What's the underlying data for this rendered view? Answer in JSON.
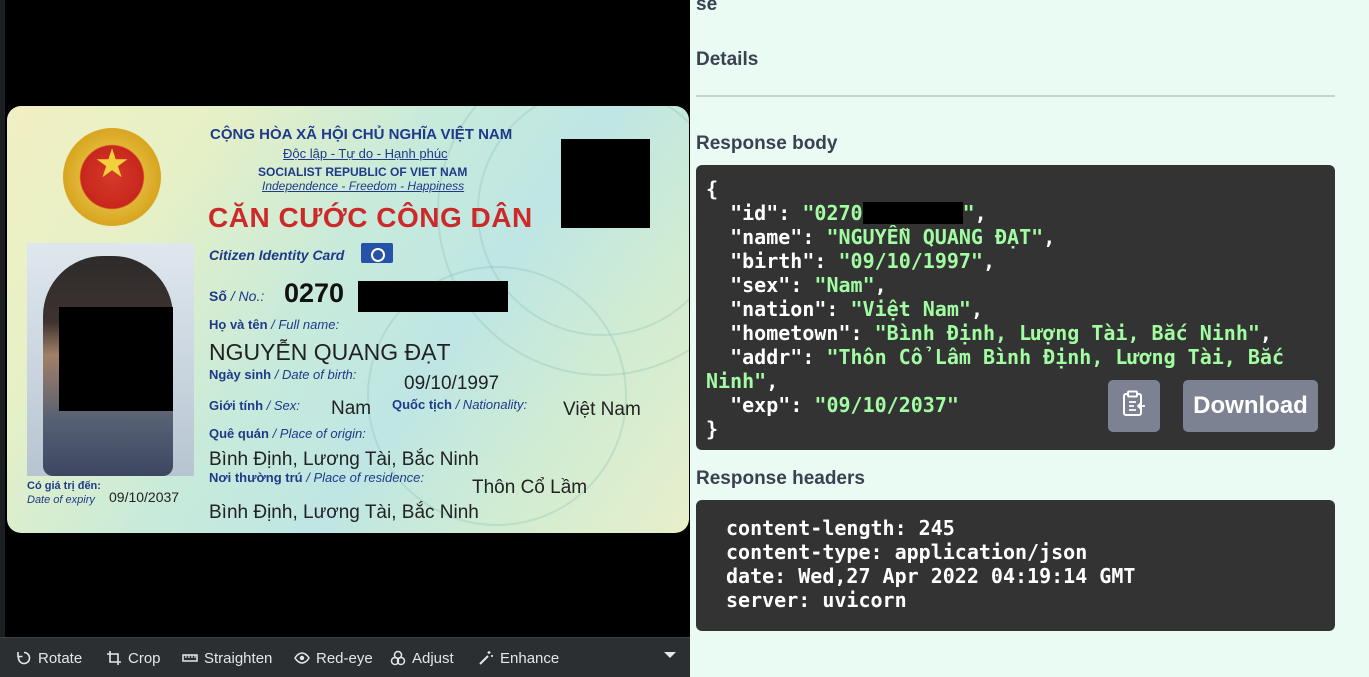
{
  "viewer": {
    "card": {
      "national_title": "CỘNG HÒA XÃ HỘI CHỦ NGHĨA VIỆT NAM",
      "motto": "Độc lập - Tự do - Hạnh phúc",
      "national_title_en": "SOCIALIST REPUBLIC OF VIET NAM",
      "motto_en": "Independence - Freedom - Happiness",
      "card_title": "CĂN CƯỚC CÔNG DÂN",
      "card_title_en": "Citizen Identity Card",
      "id_label": "Số",
      "id_label_en": "/ No.:",
      "id_number": "0270",
      "name_label": "Họ và tên",
      "name_label_en": "/ Full name:",
      "name": "NGUYỄN QUANG ĐẠT",
      "dob_label": "Ngày sinh",
      "dob_label_en": "/ Date of birth:",
      "dob": "09/10/1997",
      "sex_label": "Giới tính",
      "sex_label_en": "/ Sex:",
      "sex": "Nam",
      "nationality_label": "Quốc tịch",
      "nationality_label_en": "/ Nationality:",
      "nationality": "Việt Nam",
      "origin_label": "Quê quán",
      "origin_label_en": "/ Place of origin:",
      "origin": "Bình Định, Lương Tài, Bắc Ninh",
      "residence_label": "Nơi thường trú",
      "residence_label_en": "/ Place of residence:",
      "residence_line1": "Thôn Cổ Lầm",
      "residence_line2": "Bình Định, Lương Tài, Bắc Ninh",
      "expiry_label": "Có giá trị đến:",
      "expiry_label_en": "Date of expiry",
      "expiry": "09/10/2037"
    },
    "toolbar": {
      "rotate": "Rotate",
      "crop": "Crop",
      "straighten": "Straighten",
      "redeye": "Red-eye",
      "adjust": "Adjust",
      "enhance": "Enhance"
    }
  },
  "panel": {
    "top_partial": "se",
    "details_heading": "Details",
    "response_body_heading": "Response body",
    "response_json": {
      "open": "{",
      "close": "}",
      "id_key": "\"id\"",
      "id_value_prefix": "\"0270",
      "id_value_suffix": "\"",
      "name_key": "\"name\"",
      "name_value": "\"NGUYỄN QUANG ĐẠT\"",
      "birth_key": "\"birth\"",
      "birth_value": "\"09/10/1997\"",
      "sex_key": "\"sex\"",
      "sex_value": "\"Nam\"",
      "nation_key": "\"nation\"",
      "nation_value": "\"Việt Nam\"",
      "hometown_key": "\"hometown\"",
      "hometown_value": "\"Bình Định, Lượng Tài, Băć Ninh\"",
      "addr_key": "\"addr\"",
      "addr_value_line1": "\"Thôn Cổ Lâm Bình Định, Lương Tài, Bắc",
      "addr_value_line2": "Ninh\"",
      "exp_key": "\"exp\"",
      "exp_value": "\"09/10/2037\""
    },
    "download_label": "Download",
    "response_headers_heading": "Response headers",
    "headers": [
      "content-length: 245",
      "content-type: application/json",
      "date: Wed,27 Apr 2022 04:19:14 GMT",
      "server: uvicorn"
    ],
    "colors": {
      "background": "#e9fbf3",
      "code_bg": "#333333",
      "string_green": "#a2fca2",
      "button_gray": "#7d8293"
    }
  }
}
